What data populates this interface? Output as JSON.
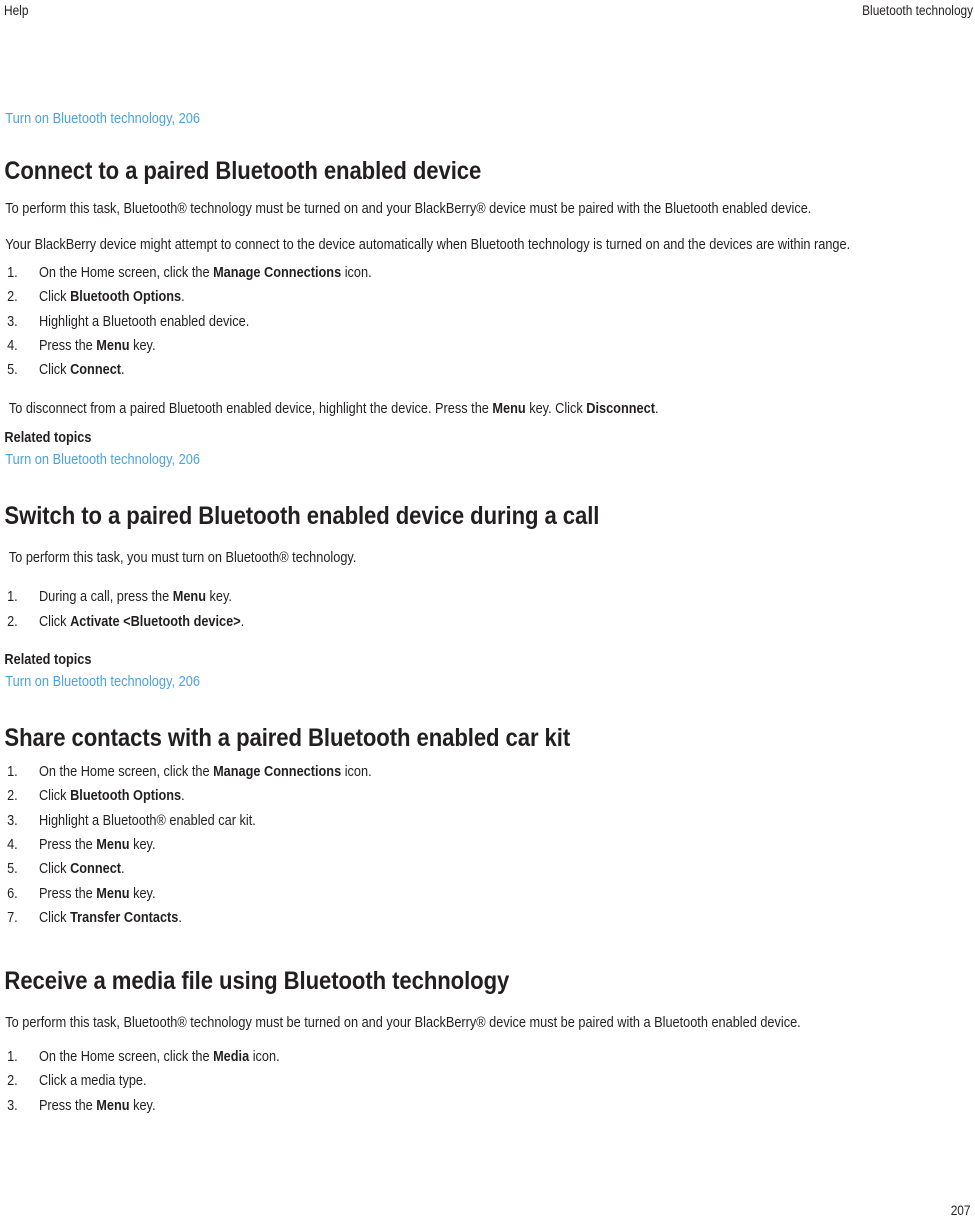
{
  "running_head": {
    "left": "Help",
    "right": "Bluetooth technology"
  },
  "top_link": "Turn on Bluetooth technology, 206",
  "related_topics_label": "Related topics",
  "sections": [
    {
      "heading": "Connect to a paired Bluetooth enabled device",
      "intro1": "To perform this task, Bluetooth® technology must be turned on and your BlackBerry® device must be paired with the Bluetooth enabled device.",
      "intro2": "Your BlackBerry device might attempt to connect to the device automatically when Bluetooth technology is turned on and the devices are within range.",
      "steps": [
        {
          "num": "1.",
          "pre": "On the Home screen, click the ",
          "bold": "Manage Connections",
          "post": " icon."
        },
        {
          "num": "2.",
          "pre": "Click ",
          "bold": "Bluetooth Options",
          "post": "."
        },
        {
          "num": "3.",
          "pre": "Highlight a Bluetooth enabled device.",
          "bold": "",
          "post": ""
        },
        {
          "num": "4.",
          "pre": "Press the ",
          "bold": "Menu",
          "post": " key."
        },
        {
          "num": "5.",
          "pre": "Click ",
          "bold": "Connect",
          "post": "."
        }
      ],
      "note_pre": "To disconnect from a paired Bluetooth enabled device, highlight the device. Press the ",
      "note_bold1": "Menu",
      "note_mid": " key. Click ",
      "note_bold2": "Disconnect",
      "note_post": ".",
      "related_link": "Turn on Bluetooth technology, 206"
    },
    {
      "heading": "Switch to a paired Bluetooth enabled device during a call",
      "intro1": "To perform this task, you must turn on Bluetooth® technology.",
      "steps": [
        {
          "num": "1.",
          "pre": "During a call, press the ",
          "bold": "Menu",
          "post": " key."
        },
        {
          "num": "2.",
          "pre": "Click ",
          "bold": "Activate <Bluetooth device>",
          "post": "."
        }
      ],
      "related_link": "Turn on Bluetooth technology, 206"
    },
    {
      "heading": "Share contacts with a paired Bluetooth enabled car kit",
      "steps": [
        {
          "num": "1.",
          "pre": "On the Home screen, click the ",
          "bold": "Manage Connections",
          "post": " icon."
        },
        {
          "num": "2.",
          "pre": "Click ",
          "bold": "Bluetooth Options",
          "post": "."
        },
        {
          "num": "3.",
          "pre": "Highlight a Bluetooth® enabled car kit.",
          "bold": "",
          "post": ""
        },
        {
          "num": "4.",
          "pre": "Press the ",
          "bold": "Menu",
          "post": " key."
        },
        {
          "num": "5.",
          "pre": "Click ",
          "bold": "Connect",
          "post": "."
        },
        {
          "num": "6.",
          "pre": "Press the ",
          "bold": "Menu",
          "post": " key."
        },
        {
          "num": "7.",
          "pre": "Click ",
          "bold": "Transfer Contacts",
          "post": "."
        }
      ]
    },
    {
      "heading": "Receive a media file using Bluetooth technology",
      "intro1": "To perform this task, Bluetooth® technology must be turned on and your BlackBerry® device must be paired with a Bluetooth enabled device.",
      "steps": [
        {
          "num": "1.",
          "pre": "On the Home screen, click the ",
          "bold": "Media",
          "post": " icon."
        },
        {
          "num": "2.",
          "pre": "Click a media type.",
          "bold": "",
          "post": ""
        },
        {
          "num": "3.",
          "pre": "Press the ",
          "bold": "Menu",
          "post": " key."
        }
      ]
    }
  ],
  "folio": "207",
  "colors": {
    "link": "#4ca3dd",
    "text": "#231f20",
    "background": "#ffffff"
  }
}
